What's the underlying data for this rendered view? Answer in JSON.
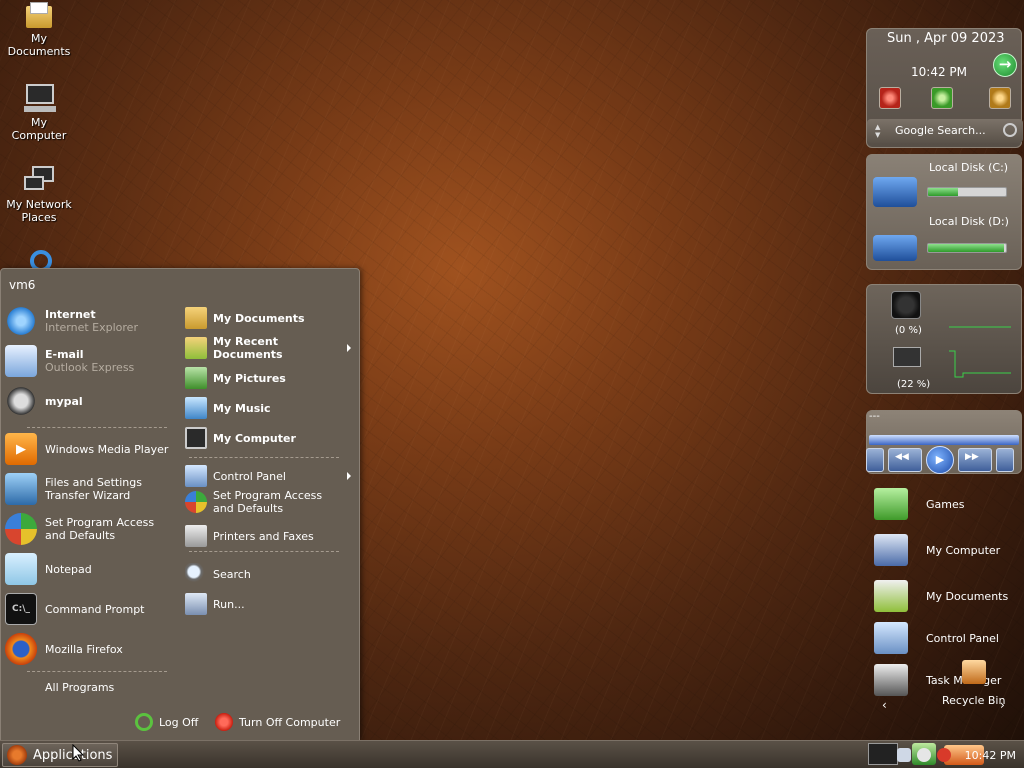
{
  "desktop_icons": [
    {
      "label": "My Documents",
      "icon": "folder-icon"
    },
    {
      "label": "My Computer",
      "icon": "computer-icon"
    },
    {
      "label": "My Network Places",
      "icon": "network-icon"
    }
  ],
  "start_menu": {
    "user": "vm6",
    "left_items": [
      {
        "main": "Internet",
        "sub": "Internet Explorer"
      },
      {
        "main": "E-mail",
        "sub": "Outlook Express"
      },
      {
        "main": "mypal",
        "sub": ""
      },
      {
        "plain": "Windows Media Player"
      },
      {
        "plain": "Files and Settings Transfer Wizard"
      },
      {
        "plain": "Set Program Access and Defaults"
      },
      {
        "plain": "Notepad"
      },
      {
        "plain": "Command Prompt"
      },
      {
        "plain": "Mozilla Firefox"
      }
    ],
    "all_programs": "All Programs",
    "right_items": [
      {
        "label": "My Documents"
      },
      {
        "label": "My Recent Documents"
      },
      {
        "label": "My Pictures"
      },
      {
        "label": "My Music"
      },
      {
        "label": "My Computer"
      },
      {
        "label": "Control Panel"
      },
      {
        "label": "Set Program Access and Defaults"
      },
      {
        "label": "Printers and Faxes"
      },
      {
        "label": "Search"
      },
      {
        "label": "Run..."
      }
    ],
    "log_off": "Log Off",
    "turn_off": "Turn Off Computer"
  },
  "taskbar": {
    "start_label": "Applications",
    "clock": "10:42 PM"
  },
  "sidebar": {
    "date": "Sun , Apr 09 2023",
    "time": "10:42 PM",
    "search_placeholder": "Google Search...",
    "disks": [
      {
        "label": "Local Disk (C:)",
        "used_fraction": 0.38
      },
      {
        "label": "Local Disk (D:)",
        "used_fraction": 0.97
      }
    ],
    "cpu_label": "(0 %)",
    "mem_label": "(22 %)",
    "media_title": "---",
    "dock": [
      {
        "label": "Games"
      },
      {
        "label": "My Computer"
      },
      {
        "label": "My Documents"
      },
      {
        "label": "Control Panel"
      },
      {
        "label": "Task Manager"
      },
      {
        "label": "Recycle Bin"
      }
    ]
  },
  "colors": {
    "menu_bg": "#665d52",
    "taskbar_bg": "#4a4239",
    "accent_green": "#2f9b2b"
  }
}
